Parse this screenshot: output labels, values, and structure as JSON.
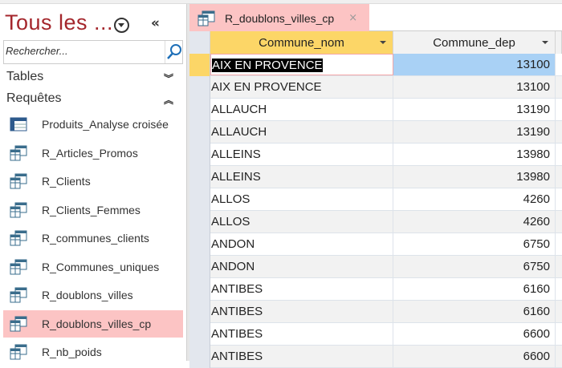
{
  "nav": {
    "title": "Tous les ...",
    "search_placeholder": "Rechercher...",
    "groups": [
      {
        "label": "Tables",
        "state": "collapsed"
      },
      {
        "label": "Requêtes",
        "state": "expanded"
      }
    ],
    "items": [
      {
        "label": "Produits_Analyse croisée",
        "icon": "crosstab-query-icon"
      },
      {
        "label": "R_Articles_Promos",
        "icon": "query-icon"
      },
      {
        "label": "R_Clients",
        "icon": "query-icon"
      },
      {
        "label": "R_Clients_Femmes",
        "icon": "query-icon"
      },
      {
        "label": "R_communes_clients",
        "icon": "query-icon"
      },
      {
        "label": "R_Communes_uniques",
        "icon": "query-icon"
      },
      {
        "label": "R_doublons_villes",
        "icon": "query-icon"
      },
      {
        "label": "R_doublons_villes_cp",
        "icon": "query-icon",
        "selected": true
      },
      {
        "label": "R_nb_poids",
        "icon": "query-icon"
      }
    ]
  },
  "tab": {
    "label": "R_doublons_villes_cp",
    "close": "×"
  },
  "grid": {
    "columns": [
      "Commune_nom",
      "Commune_dep"
    ],
    "rows": [
      [
        "AIX EN PROVENCE",
        "13100"
      ],
      [
        "AIX EN PROVENCE",
        "13100"
      ],
      [
        "ALLAUCH",
        "13190"
      ],
      [
        "ALLAUCH",
        "13190"
      ],
      [
        "ALLEINS",
        "13980"
      ],
      [
        "ALLEINS",
        "13980"
      ],
      [
        "ALLOS",
        "4260"
      ],
      [
        "ALLOS",
        "4260"
      ],
      [
        "ANDON",
        "6750"
      ],
      [
        "ANDON",
        "6750"
      ],
      [
        "ANTIBES",
        "6160"
      ],
      [
        "ANTIBES",
        "6160"
      ],
      [
        "ANTIBES",
        "6600"
      ],
      [
        "ANTIBES",
        "6600"
      ]
    ]
  },
  "colors": {
    "accent": "#a4262c",
    "selected_bg": "#fcc4c4",
    "header_active": "#fcd667",
    "cell_selected": "#a9d1f5"
  }
}
